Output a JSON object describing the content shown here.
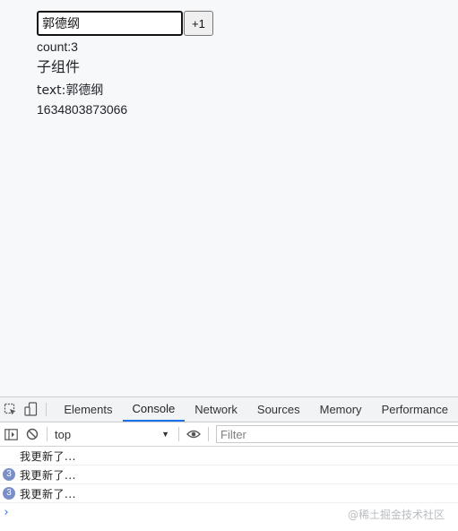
{
  "app": {
    "input_value": "郭德纲",
    "increment_label": "+1",
    "count_label": "count:",
    "count_value": "3",
    "child_title": "子组件",
    "text_label": "text:",
    "text_value": "郭德纲",
    "timestamp": "1634803873066"
  },
  "devtools": {
    "tabs": [
      "Elements",
      "Console",
      "Network",
      "Sources",
      "Memory",
      "Performance"
    ],
    "active_tab": "Console",
    "context": "top",
    "filter_placeholder": "Filter",
    "accent_color": "#1a73e8",
    "logs": [
      {
        "message": "我更新了...",
        "count": ""
      },
      {
        "message": "我更新了...",
        "count": "3"
      },
      {
        "message": "我更新了...",
        "count": "3"
      }
    ],
    "prompt": "›",
    "watermark": "@稀土掘金技术社区"
  }
}
